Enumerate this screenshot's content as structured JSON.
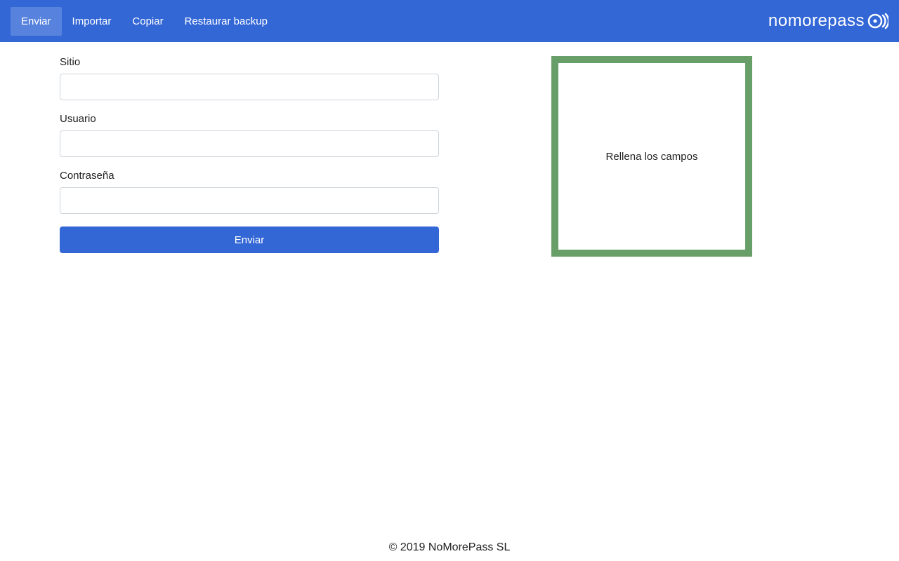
{
  "nav": {
    "tabs": [
      {
        "label": "Enviar",
        "active": true
      },
      {
        "label": "Importar",
        "active": false
      },
      {
        "label": "Copiar",
        "active": false
      },
      {
        "label": "Restaurar backup",
        "active": false
      }
    ],
    "brand": "nomorepass"
  },
  "form": {
    "site_label": "Sitio",
    "site_value": "",
    "user_label": "Usuario",
    "user_value": "",
    "password_label": "Contraseña",
    "password_value": "",
    "submit_label": "Enviar"
  },
  "panel": {
    "message": "Rellena los campos"
  },
  "footer": {
    "copyright": "© 2019 NoMorePass SL"
  }
}
